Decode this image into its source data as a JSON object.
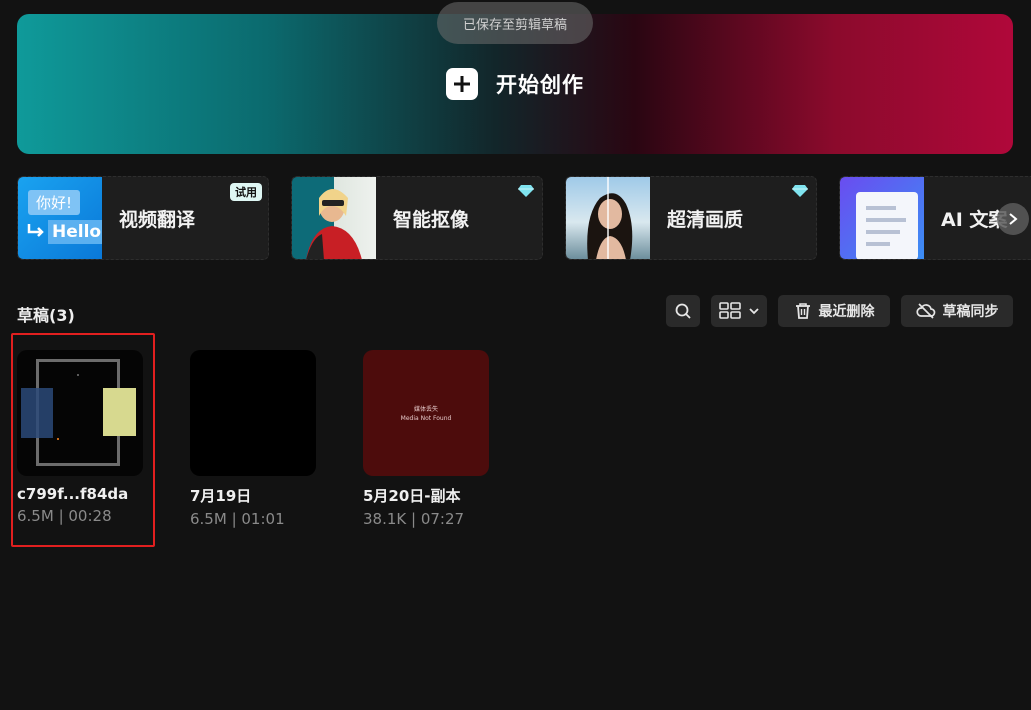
{
  "hero": {
    "label": "开始创作"
  },
  "toast": {
    "text": "已保存至剪辑草稿"
  },
  "features": [
    {
      "label": "视频翻译",
      "badge": "试用",
      "thumb_text_1": "你好!",
      "thumb_text_2": "Hello"
    },
    {
      "label": "智能抠像",
      "badge_icon": "diamond-icon"
    },
    {
      "label": "超清画质",
      "badge_icon": "diamond-icon"
    },
    {
      "label": "AI 文案"
    }
  ],
  "drafts": {
    "title": "草稿(3)",
    "items": [
      {
        "name": "c799f...f84da",
        "meta": "6.5M | 00:28"
      },
      {
        "name": "7月19日",
        "meta": "6.5M | 01:01"
      },
      {
        "name": "5月20日-副本",
        "meta": "38.1K | 07:27",
        "thumb_line_1": "媒体丢失",
        "thumb_line_2": "Media Not Found"
      }
    ]
  },
  "toolbar": {
    "recent_delete": "最近删除",
    "sync": "草稿同步"
  },
  "colors": {
    "accent_selection": "#e11f1f",
    "background": "#121212"
  }
}
